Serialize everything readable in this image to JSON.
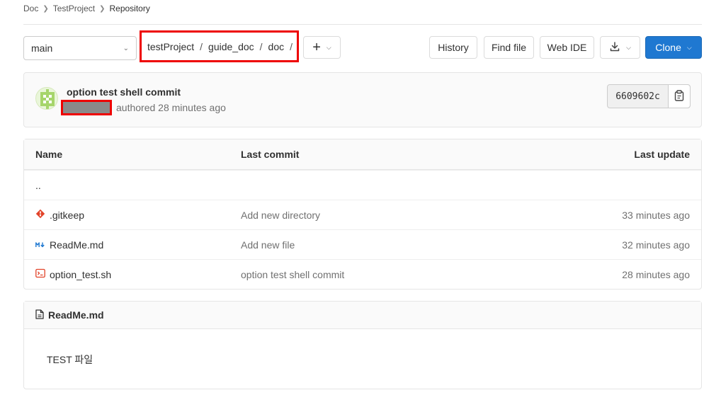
{
  "breadcrumb": {
    "items": [
      "Doc",
      "TestProject",
      "Repository"
    ]
  },
  "toolbar": {
    "branch": "main",
    "path": [
      "testProject",
      "guide_doc",
      "doc"
    ],
    "path_separator": "/",
    "plus_icon": "plus-icon",
    "history": "History",
    "find_file": "Find file",
    "web_ide": "Web IDE",
    "download_icon": "download-icon",
    "clone": "Clone"
  },
  "commit": {
    "title": "option test shell commit",
    "authored": "authored 28 minutes ago",
    "sha": "6609602c",
    "copy_icon": "clipboard-icon"
  },
  "file_table": {
    "headers": {
      "name": "Name",
      "last_commit": "Last commit",
      "last_update": "Last update"
    },
    "parent": "..",
    "rows": [
      {
        "icon": "git-icon",
        "name": ".gitkeep",
        "commit": "Add new directory",
        "updated": "33 minutes ago"
      },
      {
        "icon": "markdown-icon",
        "name": "ReadMe.md",
        "commit": "Add new file",
        "updated": "32 minutes ago"
      },
      {
        "icon": "terminal-file-icon",
        "name": "option_test.sh",
        "commit": "option test shell commit",
        "updated": "28 minutes ago"
      }
    ]
  },
  "readme": {
    "filename": "ReadMe.md",
    "content": "TEST 파일"
  },
  "colors": {
    "accent": "#1f78d1",
    "highlight_border": "#ee0000",
    "git_icon": "#e24329",
    "markdown_icon": "#1f78d1",
    "terminal_icon": "#e24329"
  }
}
